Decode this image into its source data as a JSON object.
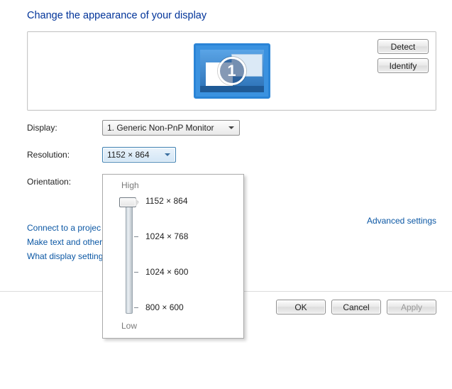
{
  "title": "Change the appearance of your display",
  "monitorNumber": "1",
  "buttons": {
    "detect": "Detect",
    "identify": "Identify",
    "ok": "OK",
    "cancel": "Cancel",
    "apply": "Apply"
  },
  "labels": {
    "display": "Display:",
    "resolution": "Resolution:",
    "orientation": "Orientation:"
  },
  "display": {
    "selected": "1. Generic Non-PnP Monitor"
  },
  "resolution": {
    "selected": "1152 × 864",
    "sliderHigh": "High",
    "sliderLow": "Low",
    "options": [
      "1152 × 864",
      "1024 × 768",
      "1024 × 600",
      "800 × 600"
    ]
  },
  "links": {
    "advanced": "Advanced settings",
    "projector": "Connect to a projec",
    "text": "Make text and other",
    "what": "What display setting"
  }
}
